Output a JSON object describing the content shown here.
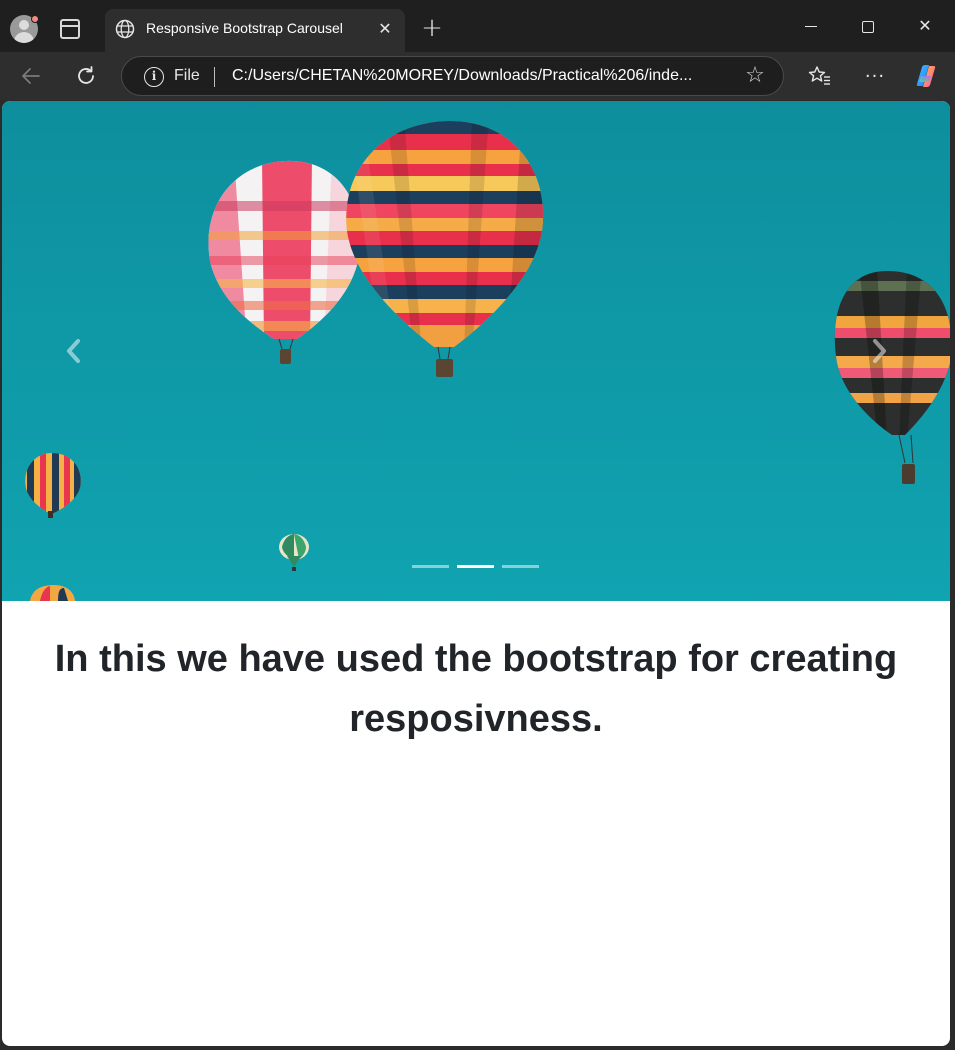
{
  "browser": {
    "tab": {
      "title": "Responsive Bootstrap Carousel",
      "favicon": "globe-icon",
      "close_glyph": "✕"
    },
    "new_tab_glyph": "+",
    "window_controls": {
      "close_glyph": "✕"
    },
    "address_bar": {
      "scheme_label": "File",
      "url": "C:/Users/CHETAN%20MOREY/Downloads/Practical%206/inde..."
    },
    "more_glyph": "···",
    "favorite_glyph": "☆"
  },
  "page": {
    "carousel": {
      "slide_count": 3,
      "active_slide": 2,
      "prev_glyph": "‹",
      "next_glyph": "›"
    },
    "heading": "In this we have used the bootstrap for creating resposivness."
  },
  "colors": {
    "sky": "#0f98a6",
    "text": "#212529",
    "chrome_dark": "#1f1f1f",
    "chrome_tab": "#2e2e2e"
  }
}
